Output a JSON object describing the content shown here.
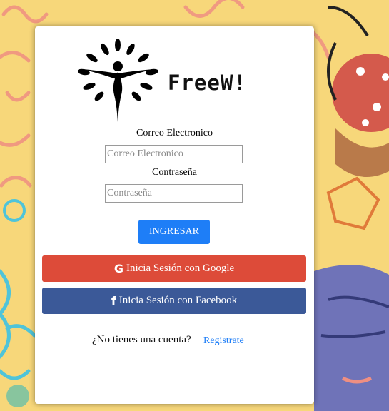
{
  "app": {
    "brand": "FreeW!"
  },
  "login": {
    "email_label": "Correo Electronico",
    "email_placeholder": "Correo Electronico",
    "password_label": "Contraseña",
    "password_placeholder": "Contraseña",
    "submit_label": "INGRESAR"
  },
  "social": {
    "google_icon": "G",
    "google_label": "Inicia Sesión con Google",
    "facebook_icon": "f",
    "facebook_label": "Inicia Sesión con Facebook"
  },
  "signup": {
    "question": "¿No tienes una cuenta?",
    "link_label": "Registrate"
  },
  "colors": {
    "accent_top": "#1aa37f",
    "primary": "#1e7ef7",
    "google": "#dd4b39",
    "facebook": "#3b5998"
  }
}
